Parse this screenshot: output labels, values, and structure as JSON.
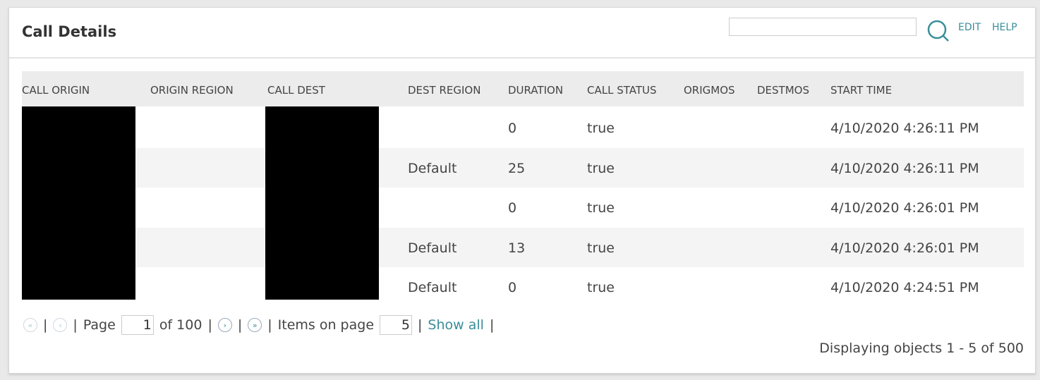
{
  "title": "Call Details",
  "header": {
    "search_value": "",
    "edit": "EDIT",
    "help": "HELP"
  },
  "columns": [
    "CALL ORIGIN",
    "ORIGIN REGION",
    "CALL DEST",
    "DEST REGION",
    "DURATION",
    "CALL STATUS",
    "ORIGMOS",
    "DESTMOS",
    "START TIME"
  ],
  "rows": [
    {
      "origin": "",
      "origin_region": "",
      "dest": "",
      "dest_region": "",
      "duration": "0",
      "status": "true",
      "origmos": "",
      "destmos": "",
      "start": "4/10/2020 4:26:11 PM"
    },
    {
      "origin": "",
      "origin_region": "",
      "dest": "",
      "dest_region": "Default",
      "duration": "25",
      "status": "true",
      "origmos": "",
      "destmos": "",
      "start": "4/10/2020 4:26:11 PM"
    },
    {
      "origin": "",
      "origin_region": "",
      "dest": "",
      "dest_region": "",
      "duration": "0",
      "status": "true",
      "origmos": "",
      "destmos": "",
      "start": "4/10/2020 4:26:01 PM"
    },
    {
      "origin": "",
      "origin_region": "",
      "dest": "",
      "dest_region": "Default",
      "duration": "13",
      "status": "true",
      "origmos": "",
      "destmos": "",
      "start": "4/10/2020 4:26:01 PM"
    },
    {
      "origin": "",
      "origin_region": "",
      "dest": "",
      "dest_region": "Default",
      "duration": "0",
      "status": "true",
      "origmos": "",
      "destmos": "",
      "start": "4/10/2020 4:24:51 PM"
    }
  ],
  "pager": {
    "sep": "|",
    "page_label": "Page",
    "page": "1",
    "of": "of 100",
    "items_label": "Items on page",
    "items": "5",
    "show_all": "Show all"
  },
  "display": "Displaying objects 1 - 5 of 500"
}
